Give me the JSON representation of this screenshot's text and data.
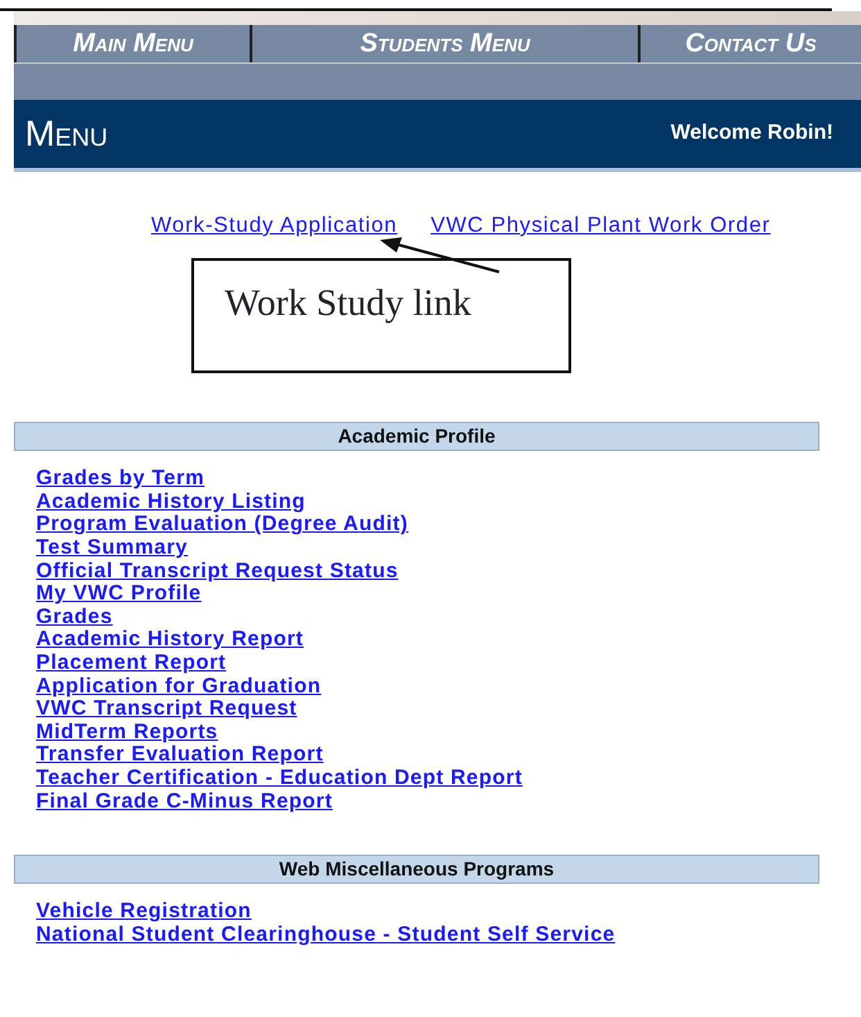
{
  "nav_tabs": [
    {
      "label": "Main Menu"
    },
    {
      "label": "Students Menu"
    },
    {
      "label": "Contact Us"
    }
  ],
  "header": {
    "title": "Menu",
    "welcome": "Welcome Robin!"
  },
  "top_links": [
    "Work-Study Application",
    "VWC Physical Plant Work Order"
  ],
  "annotation": {
    "text": "Work Study link"
  },
  "sections": [
    {
      "title": "Academic Profile",
      "links": [
        "Grades by Term",
        "Academic History Listing",
        "Program Evaluation (Degree Audit)",
        "Test Summary",
        "Official Transcript Request Status",
        "My VWC Profile",
        "Grades",
        "Academic History Report",
        "Placement Report",
        "Application for Graduation",
        "VWC Transcript Request",
        "MidTerm Reports",
        "Transfer Evaluation Report",
        "Teacher Certification - Education Dept Report",
        "Final Grade C-Minus Report"
      ]
    },
    {
      "title": "Web Miscellaneous Programs",
      "links": [
        "Vehicle Registration",
        "National Student Clearinghouse - Student Self Service"
      ]
    }
  ]
}
